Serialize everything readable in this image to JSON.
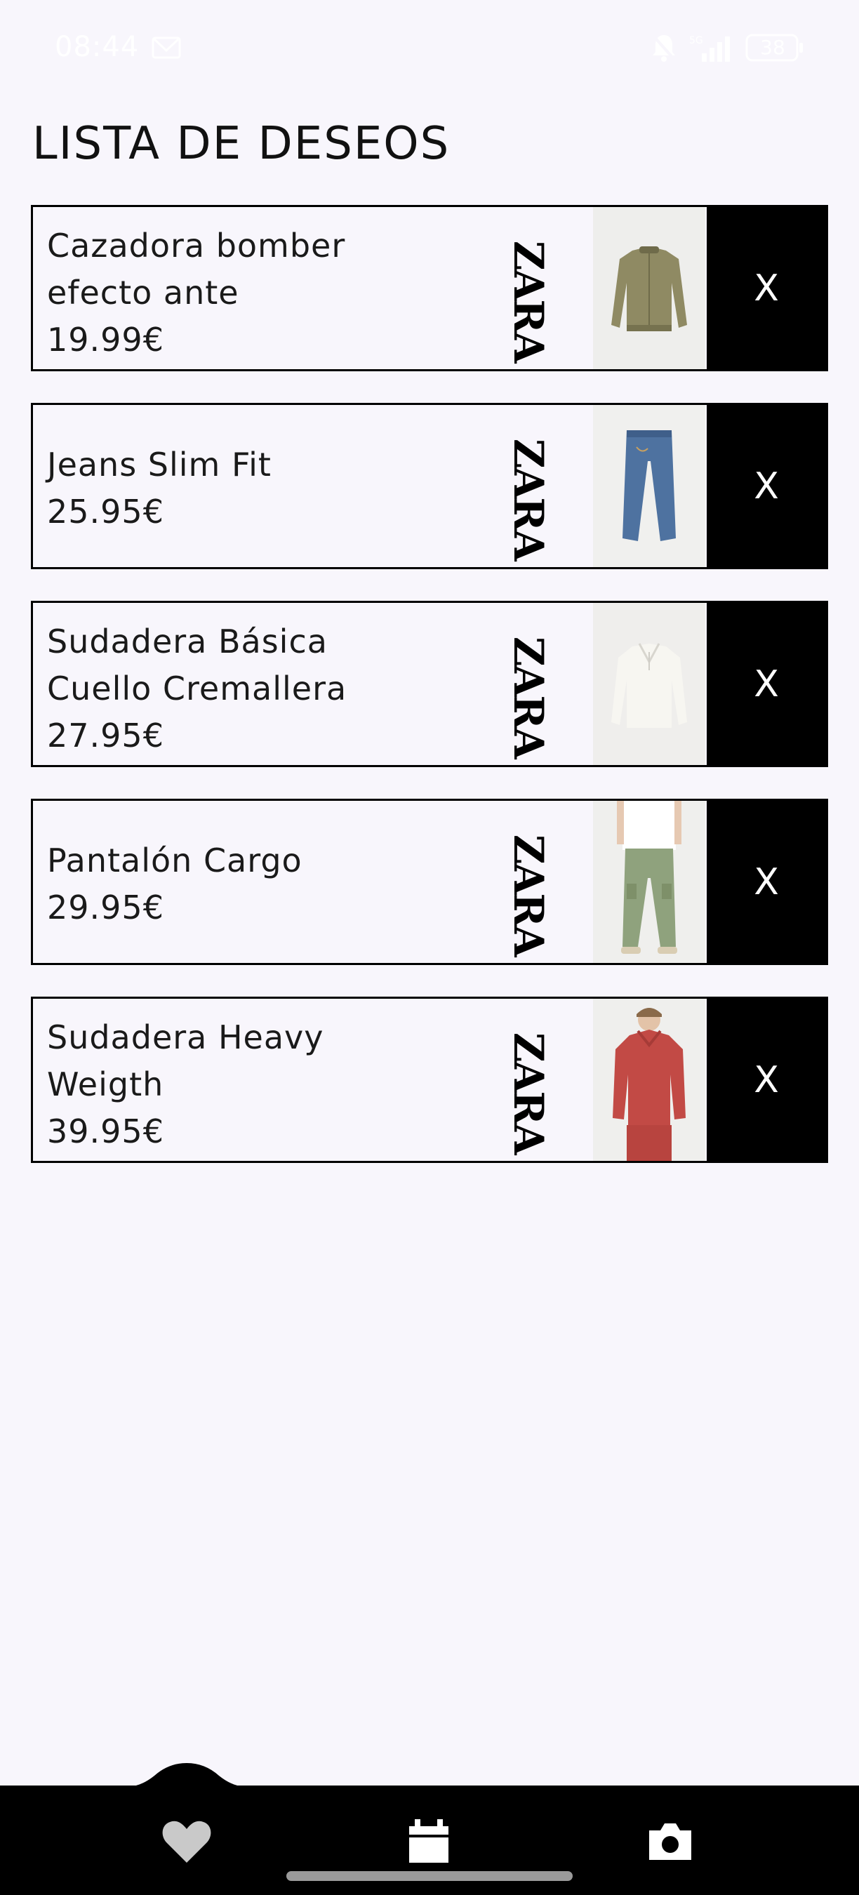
{
  "status_bar": {
    "time": "08:44",
    "battery": "38"
  },
  "page": {
    "title": "LISTA DE DESEOS"
  },
  "wishlist": {
    "items": [
      {
        "name_line1": "Cazadora bomber",
        "name_line2": "efecto ante",
        "price": "19.99€",
        "brand": "ZARA",
        "remove_label": "X",
        "image": "olive-bomber-jacket"
      },
      {
        "name_line1": "Jeans Slim Fit",
        "name_line2": "",
        "price": "25.95€",
        "brand": "ZARA",
        "remove_label": "X",
        "image": "blue-jeans"
      },
      {
        "name_line1": "Sudadera Básica",
        "name_line2": "Cuello Cremallera",
        "price": "27.95€",
        "brand": "ZARA",
        "remove_label": "X",
        "image": "white-zip-sweatshirt"
      },
      {
        "name_line1": "Pantalón Cargo",
        "name_line2": "",
        "price": "29.95€",
        "brand": "ZARA",
        "remove_label": "X",
        "image": "green-cargo-pants"
      },
      {
        "name_line1": "Sudadera Heavy",
        "name_line2": "Weigth",
        "price": "39.95€",
        "brand": "ZARA",
        "remove_label": "X",
        "image": "red-hoodie"
      }
    ]
  },
  "bottom_nav": {
    "items": [
      {
        "icon": "heart-icon",
        "active": true
      },
      {
        "icon": "calendar-icon",
        "active": false
      },
      {
        "icon": "camera-icon",
        "active": false
      }
    ]
  },
  "colors": {
    "background": "#f8f6fc",
    "accent": "#000000",
    "nav_icon": "#ffffff"
  }
}
